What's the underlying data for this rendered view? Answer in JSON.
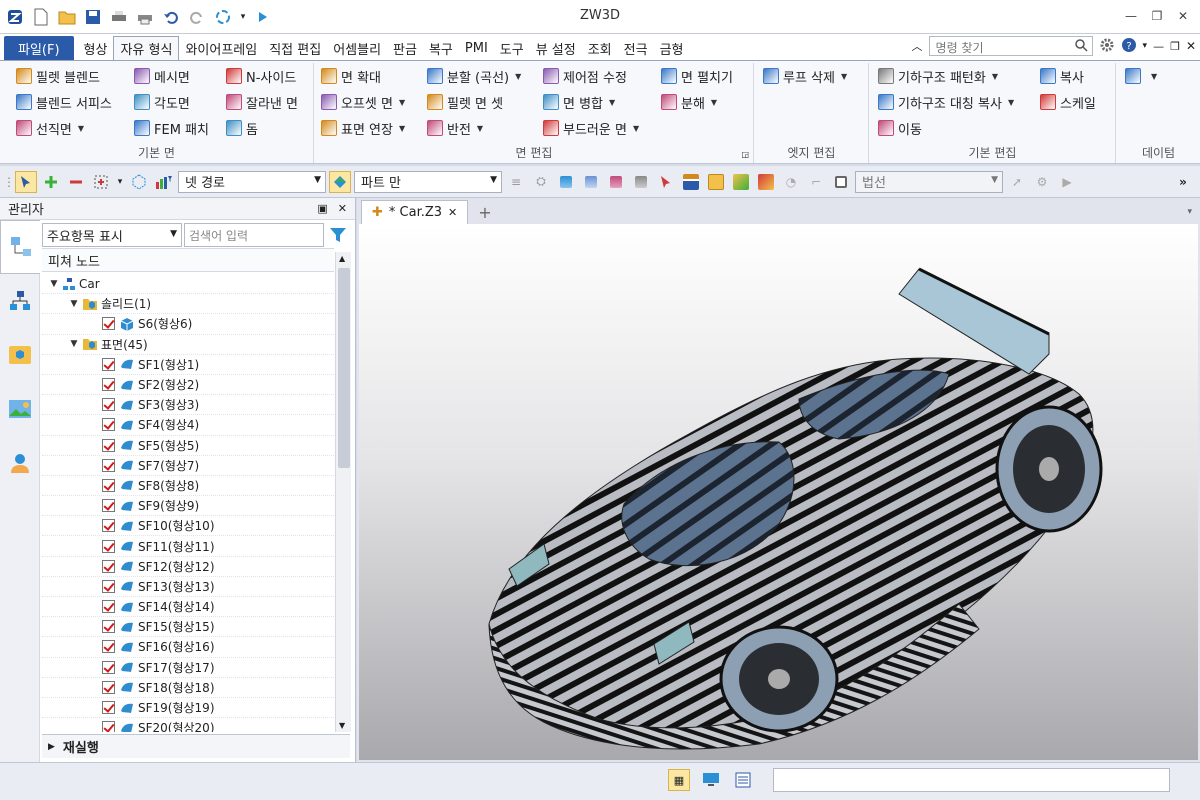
{
  "app": {
    "title": "ZW3D"
  },
  "menu": {
    "file": "파일(F)",
    "items": [
      "형상",
      "자유 형식",
      "와이어프레임",
      "직접 편집",
      "어셈블리",
      "판금",
      "복구",
      "PMI",
      "도구",
      "뷰 설정",
      "조회",
      "전극",
      "금형"
    ],
    "active_index": 1,
    "search_placeholder": "명령 찾기"
  },
  "ribbon": {
    "groups": [
      {
        "label": "기본 면",
        "items": [
          {
            "label": "필렛 블렌드",
            "dropdown": false,
            "icon": "fillet-blend-icon",
            "color": "#d48a1a"
          },
          {
            "label": "블렌드 서피스",
            "dropdown": false,
            "icon": "blend-surface-icon",
            "color": "#3a78c9"
          },
          {
            "label": "선직면",
            "dropdown": true,
            "icon": "ruled-surface-icon",
            "color": "#c04a7a"
          },
          {
            "label": "메시면",
            "dropdown": false,
            "icon": "mesh-surface-icon",
            "color": "#8a5ab0"
          },
          {
            "label": "각도면",
            "dropdown": false,
            "icon": "angle-surface-icon",
            "color": "#3d8fc4"
          },
          {
            "label": "FEM 패치",
            "dropdown": false,
            "icon": "fem-patch-icon",
            "color": "#3a78c9"
          },
          {
            "label": "N-사이드",
            "dropdown": false,
            "icon": "n-side-icon",
            "color": "#d13a3a"
          },
          {
            "label": "잘라낸 면",
            "dropdown": false,
            "icon": "cut-surface-icon",
            "color": "#c04a7a"
          },
          {
            "label": "돔",
            "dropdown": false,
            "icon": "dome-icon",
            "color": "#3d8fc4"
          }
        ]
      },
      {
        "label": "면 편집",
        "items": [
          {
            "label": "면 확대",
            "dropdown": false,
            "icon": "extend-face-icon",
            "color": "#d48a1a"
          },
          {
            "label": "오프셋 면",
            "dropdown": true,
            "icon": "offset-face-icon",
            "color": "#8a5ab0"
          },
          {
            "label": "표면 연장",
            "dropdown": true,
            "icon": "surface-extend-icon",
            "color": "#d48a1a"
          },
          {
            "label": "분할 (곡선)",
            "dropdown": true,
            "icon": "split-curve-icon",
            "color": "#3a78c9"
          },
          {
            "label": "필렛 면 셋",
            "dropdown": false,
            "icon": "fillet-face-set-icon",
            "color": "#d48a1a"
          },
          {
            "label": "반전",
            "dropdown": true,
            "icon": "reverse-icon",
            "color": "#c04a7a"
          },
          {
            "label": "제어점 수정",
            "dropdown": false,
            "icon": "control-point-icon",
            "color": "#8a5ab0"
          },
          {
            "label": "면 병합",
            "dropdown": true,
            "icon": "merge-face-icon",
            "color": "#3d8fc4"
          },
          {
            "label": "부드러운 면",
            "dropdown": true,
            "icon": "smooth-face-icon",
            "color": "#d13a3a"
          },
          {
            "label": "면 펼치기",
            "dropdown": false,
            "icon": "unfold-face-icon",
            "color": "#3a78c9"
          },
          {
            "label": "분해",
            "dropdown": true,
            "icon": "explode-icon",
            "color": "#c04a7a"
          }
        ]
      },
      {
        "label": "엣지 편집",
        "items": [
          {
            "label": "루프 삭제",
            "dropdown": true,
            "icon": "delete-loop-icon",
            "color": "#3a78c9"
          }
        ]
      },
      {
        "label": "기본 편집",
        "items": [
          {
            "label": "기하구조 패턴화",
            "dropdown": true,
            "icon": "pattern-icon",
            "color": "#7a7a7a"
          },
          {
            "label": "기하구조 대칭 복사",
            "dropdown": true,
            "icon": "mirror-icon",
            "color": "#3a78c9"
          },
          {
            "label": "이동",
            "dropdown": false,
            "icon": "move-icon",
            "color": "#c04a7a"
          },
          {
            "label": "복사",
            "dropdown": false,
            "icon": "copy-icon",
            "color": "#3a78c9"
          },
          {
            "label": "스케일",
            "dropdown": false,
            "icon": "scale-icon",
            "color": "#d13a3a"
          }
        ]
      },
      {
        "label": "데이텀",
        "items": [
          {
            "label": "",
            "dropdown": true,
            "icon": "datum-icon",
            "color": "#3a78c9"
          }
        ]
      }
    ]
  },
  "toolbar": {
    "filter_combo": "넷 경로",
    "part_combo": "파트 만",
    "normal_combo": "법선"
  },
  "manager": {
    "title": "관리자",
    "filter_select": "주요항목 표시",
    "search_placeholder": "검색어 입력",
    "column_header": "피쳐 노드",
    "recalc_label": "재실행",
    "tree": [
      {
        "label": "Car",
        "level": 0,
        "twisty": "▼",
        "check": false,
        "icon": "assembly-icon"
      },
      {
        "label": "솔리드(1)",
        "level": 1,
        "twisty": "▼",
        "check": false,
        "icon": "folder-icon"
      },
      {
        "label": "S6(형상6)",
        "level": 2,
        "twisty": "",
        "check": true,
        "icon": "solid-icon"
      },
      {
        "label": "표면(45)",
        "level": 1,
        "twisty": "▼",
        "check": false,
        "icon": "folder-icon"
      },
      {
        "label": "SF1(형상1)",
        "level": 2,
        "twisty": "",
        "check": true,
        "icon": "surface-icon"
      },
      {
        "label": "SF2(형상2)",
        "level": 2,
        "twisty": "",
        "check": true,
        "icon": "surface-icon"
      },
      {
        "label": "SF3(형상3)",
        "level": 2,
        "twisty": "",
        "check": true,
        "icon": "surface-icon"
      },
      {
        "label": "SF4(형상4)",
        "level": 2,
        "twisty": "",
        "check": true,
        "icon": "surface-icon"
      },
      {
        "label": "SF5(형상5)",
        "level": 2,
        "twisty": "",
        "check": true,
        "icon": "surface-icon"
      },
      {
        "label": "SF7(형상7)",
        "level": 2,
        "twisty": "",
        "check": true,
        "icon": "surface-icon"
      },
      {
        "label": "SF8(형상8)",
        "level": 2,
        "twisty": "",
        "check": true,
        "icon": "surface-icon"
      },
      {
        "label": "SF9(형상9)",
        "level": 2,
        "twisty": "",
        "check": true,
        "icon": "surface-icon"
      },
      {
        "label": "SF10(형상10)",
        "level": 2,
        "twisty": "",
        "check": true,
        "icon": "surface-icon"
      },
      {
        "label": "SF11(형상11)",
        "level": 2,
        "twisty": "",
        "check": true,
        "icon": "surface-icon"
      },
      {
        "label": "SF12(형상12)",
        "level": 2,
        "twisty": "",
        "check": true,
        "icon": "surface-icon"
      },
      {
        "label": "SF13(형상13)",
        "level": 2,
        "twisty": "",
        "check": true,
        "icon": "surface-icon"
      },
      {
        "label": "SF14(형상14)",
        "level": 2,
        "twisty": "",
        "check": true,
        "icon": "surface-icon"
      },
      {
        "label": "SF15(형상15)",
        "level": 2,
        "twisty": "",
        "check": true,
        "icon": "surface-icon"
      },
      {
        "label": "SF16(형상16)",
        "level": 2,
        "twisty": "",
        "check": true,
        "icon": "surface-icon"
      },
      {
        "label": "SF17(형상17)",
        "level": 2,
        "twisty": "",
        "check": true,
        "icon": "surface-icon"
      },
      {
        "label": "SF18(형상18)",
        "level": 2,
        "twisty": "",
        "check": true,
        "icon": "surface-icon"
      },
      {
        "label": "SF19(형상19)",
        "level": 2,
        "twisty": "",
        "check": true,
        "icon": "surface-icon"
      },
      {
        "label": "SF20(형상20)",
        "level": 2,
        "twisty": "",
        "check": true,
        "icon": "surface-icon"
      }
    ]
  },
  "document": {
    "tab_label": "* Car.Z3"
  },
  "colors": {
    "accent": "#2b5ba8",
    "check": "#d21a1a",
    "surface_icon": "#2e8ccf",
    "folder": "#e8b838"
  }
}
